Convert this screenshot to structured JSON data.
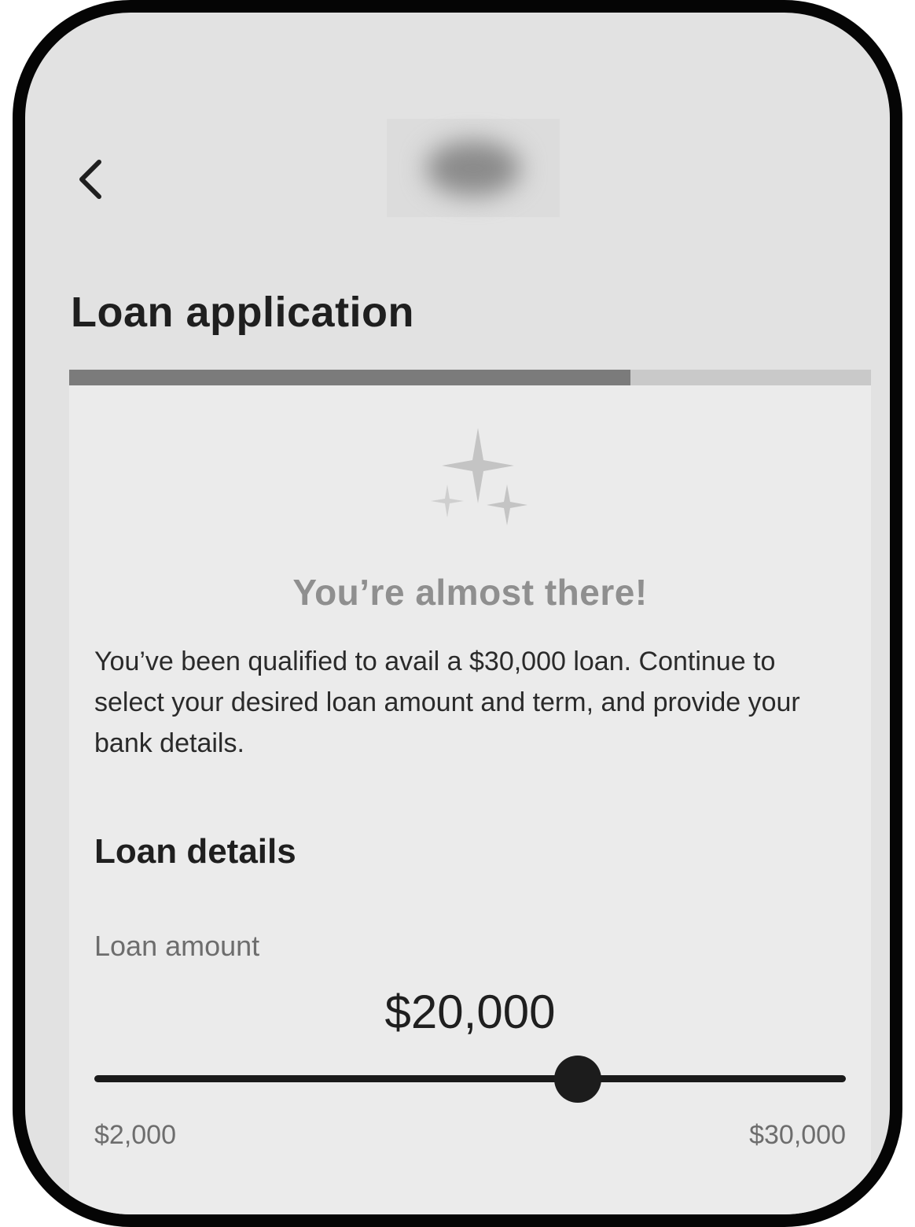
{
  "header": {
    "back_icon": "chevron-left-icon",
    "logo_icon": "blurred-brand-logo"
  },
  "page": {
    "title": "Loan application"
  },
  "progress": {
    "fraction": 0.7
  },
  "qualification": {
    "icon": "sparkles-icon",
    "heading": "You’re almost there!",
    "message": "You’ve been qualified to avail a $30,000 loan. Continue to select your desired loan amount and term, and provide your bank details."
  },
  "loan_details": {
    "section_title": "Loan details",
    "amount_label": "Loan amount",
    "amount_display": "$20,000",
    "slider": {
      "value": 20000,
      "min": 2000,
      "max": 30000,
      "min_label": "$2,000",
      "max_label": "$30,000"
    }
  },
  "colors": {
    "screen_background": "#e2e2e2",
    "card_background": "#ebebeb",
    "progress_fill": "#7b7b7b",
    "progress_track": "#c9c9c9",
    "heading_gray": "#8f8f8f",
    "text_dark": "#1f1f1f",
    "phone_frame": "#050505"
  }
}
